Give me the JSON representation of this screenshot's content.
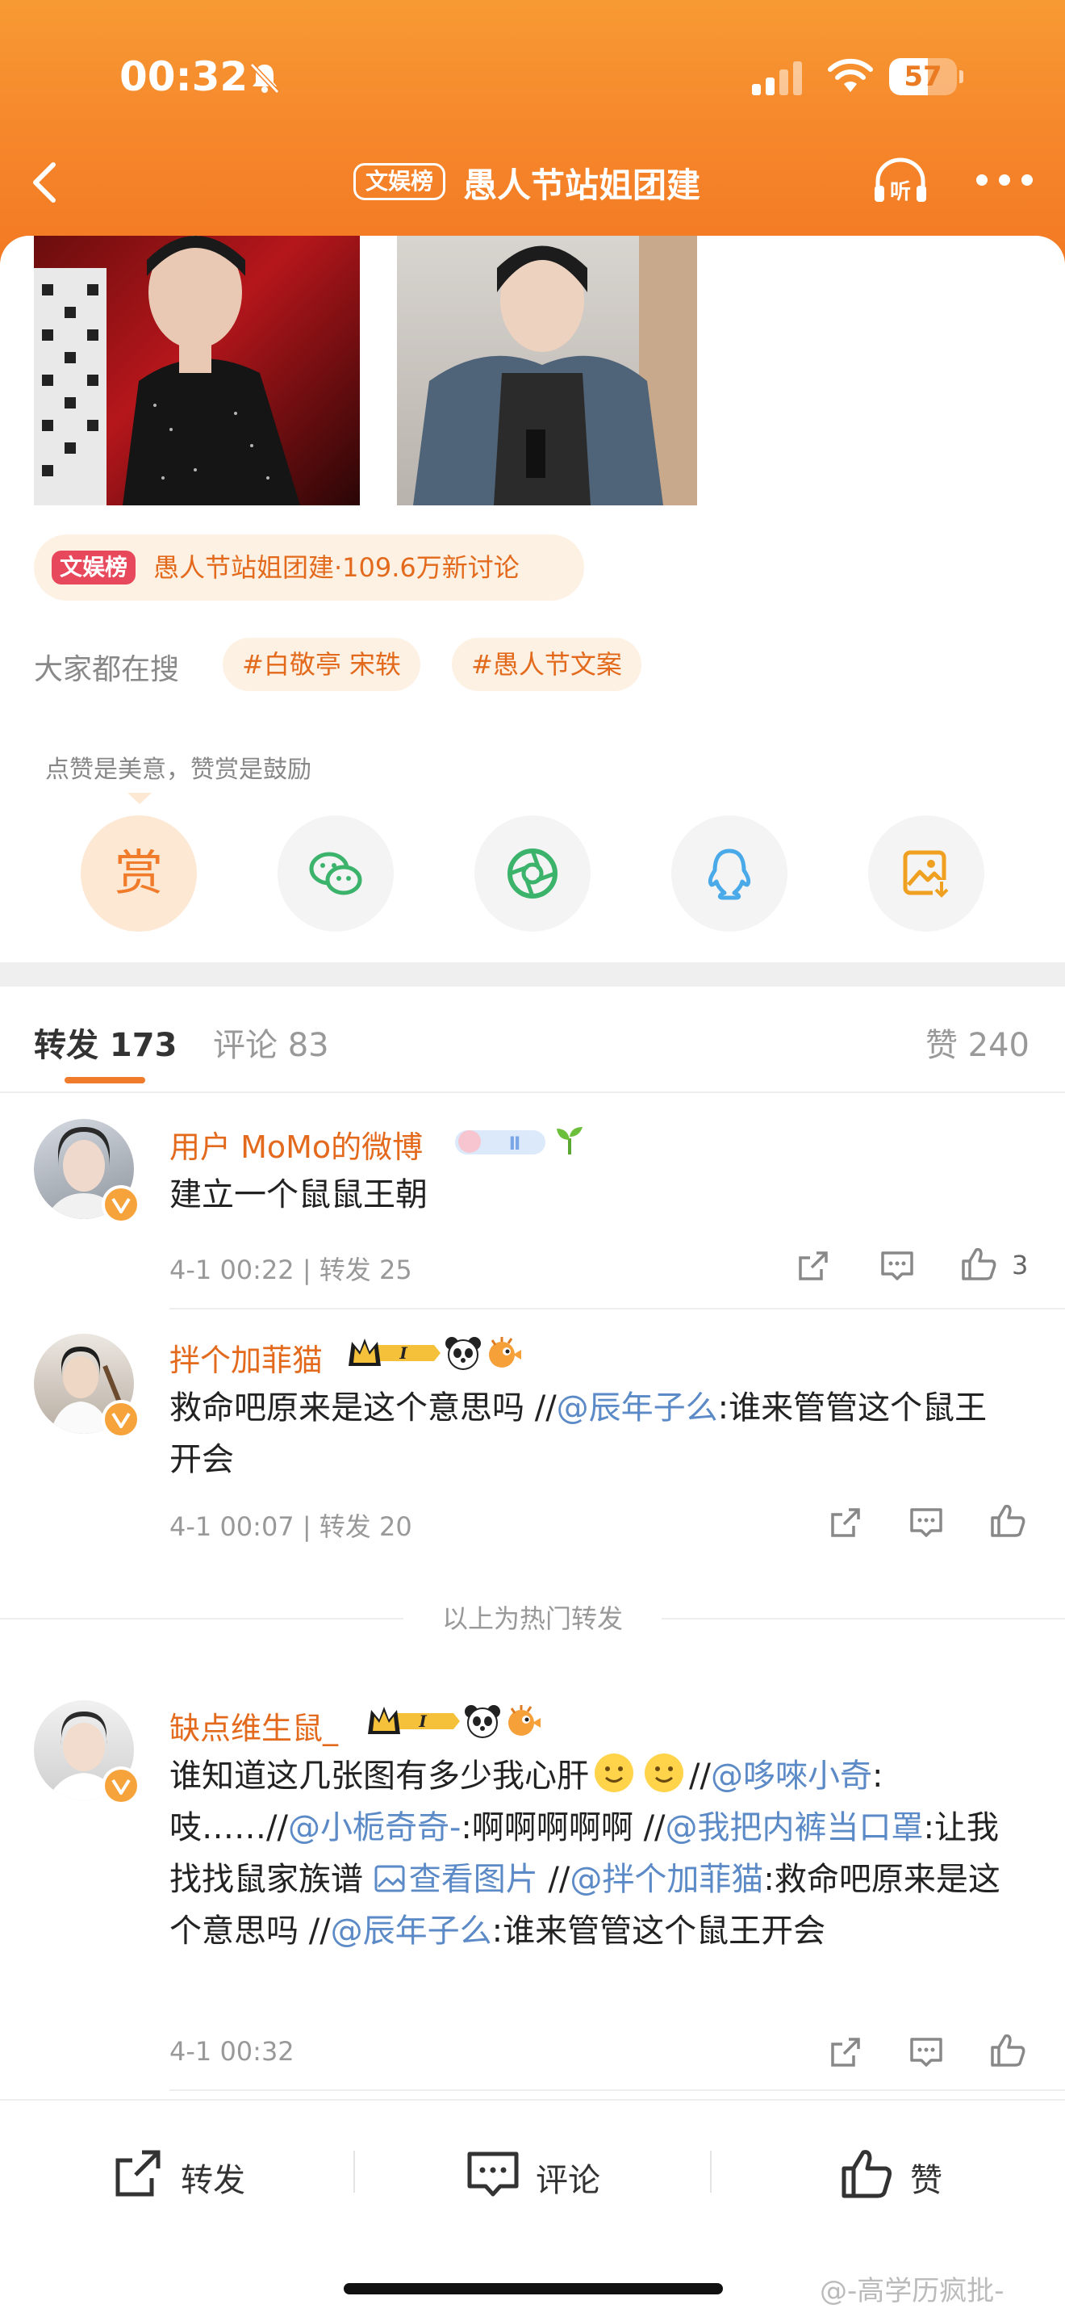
{
  "status_bar": {
    "time": "00:32",
    "battery": "57"
  },
  "nav": {
    "badge": "文娱榜",
    "title": "愚人节站姐团建"
  },
  "topic": {
    "badge": "文娱榜",
    "text": "愚人节站姐团建·109.6万新讨论"
  },
  "search": {
    "label": "大家都在搜",
    "tags": [
      "#白敬亭 宋轶",
      "#愚人节文案"
    ]
  },
  "reward_hint": "点赞是美意，赞赏是鼓励",
  "share": {
    "reward_label": "赏"
  },
  "tabs": {
    "reposts": "转发 173",
    "comments": "评论 83",
    "likes": "赞 240"
  },
  "entries": [
    {
      "name": "用户 MoMo的微博",
      "content": "建立一个鼠鼠王朝",
      "meta": "4-1 00:22 | 转发 25",
      "likes": "3"
    },
    {
      "name": "拌个加菲猫",
      "content_parts": [
        "救命吧原来是这个意思吗 //",
        "@辰年子么",
        ":谁来管管这个鼠王开会"
      ],
      "meta": "4-1 00:07 | 转发 20"
    },
    {
      "name": "缺点维生鼠_",
      "content_parts": [
        "谁知道这几张图有多少我心肝",
        "//",
        "@哆唻小奇",
        ":吱……//",
        "@小栀奇奇-",
        ":啊啊啊啊啊 //",
        "@我把内裤当口罩",
        ":让我找找鼠家族谱 ",
        "查看图片",
        " //",
        "@拌个加菲猫",
        ":救命吧原来是这个意思吗 //",
        "@辰年子么",
        ":谁来管管这个鼠王开会"
      ],
      "meta": "4-1 00:32"
    }
  ],
  "hot_separator": "以上为热门转发",
  "bottom_bar": {
    "repost": "转发",
    "comment": "评论",
    "like": "赞"
  },
  "watermark": "@-高学历疯批-",
  "colors": {
    "accent": "#f07c2b",
    "mention": "#5b8ac7",
    "username": "#e36a1c"
  }
}
